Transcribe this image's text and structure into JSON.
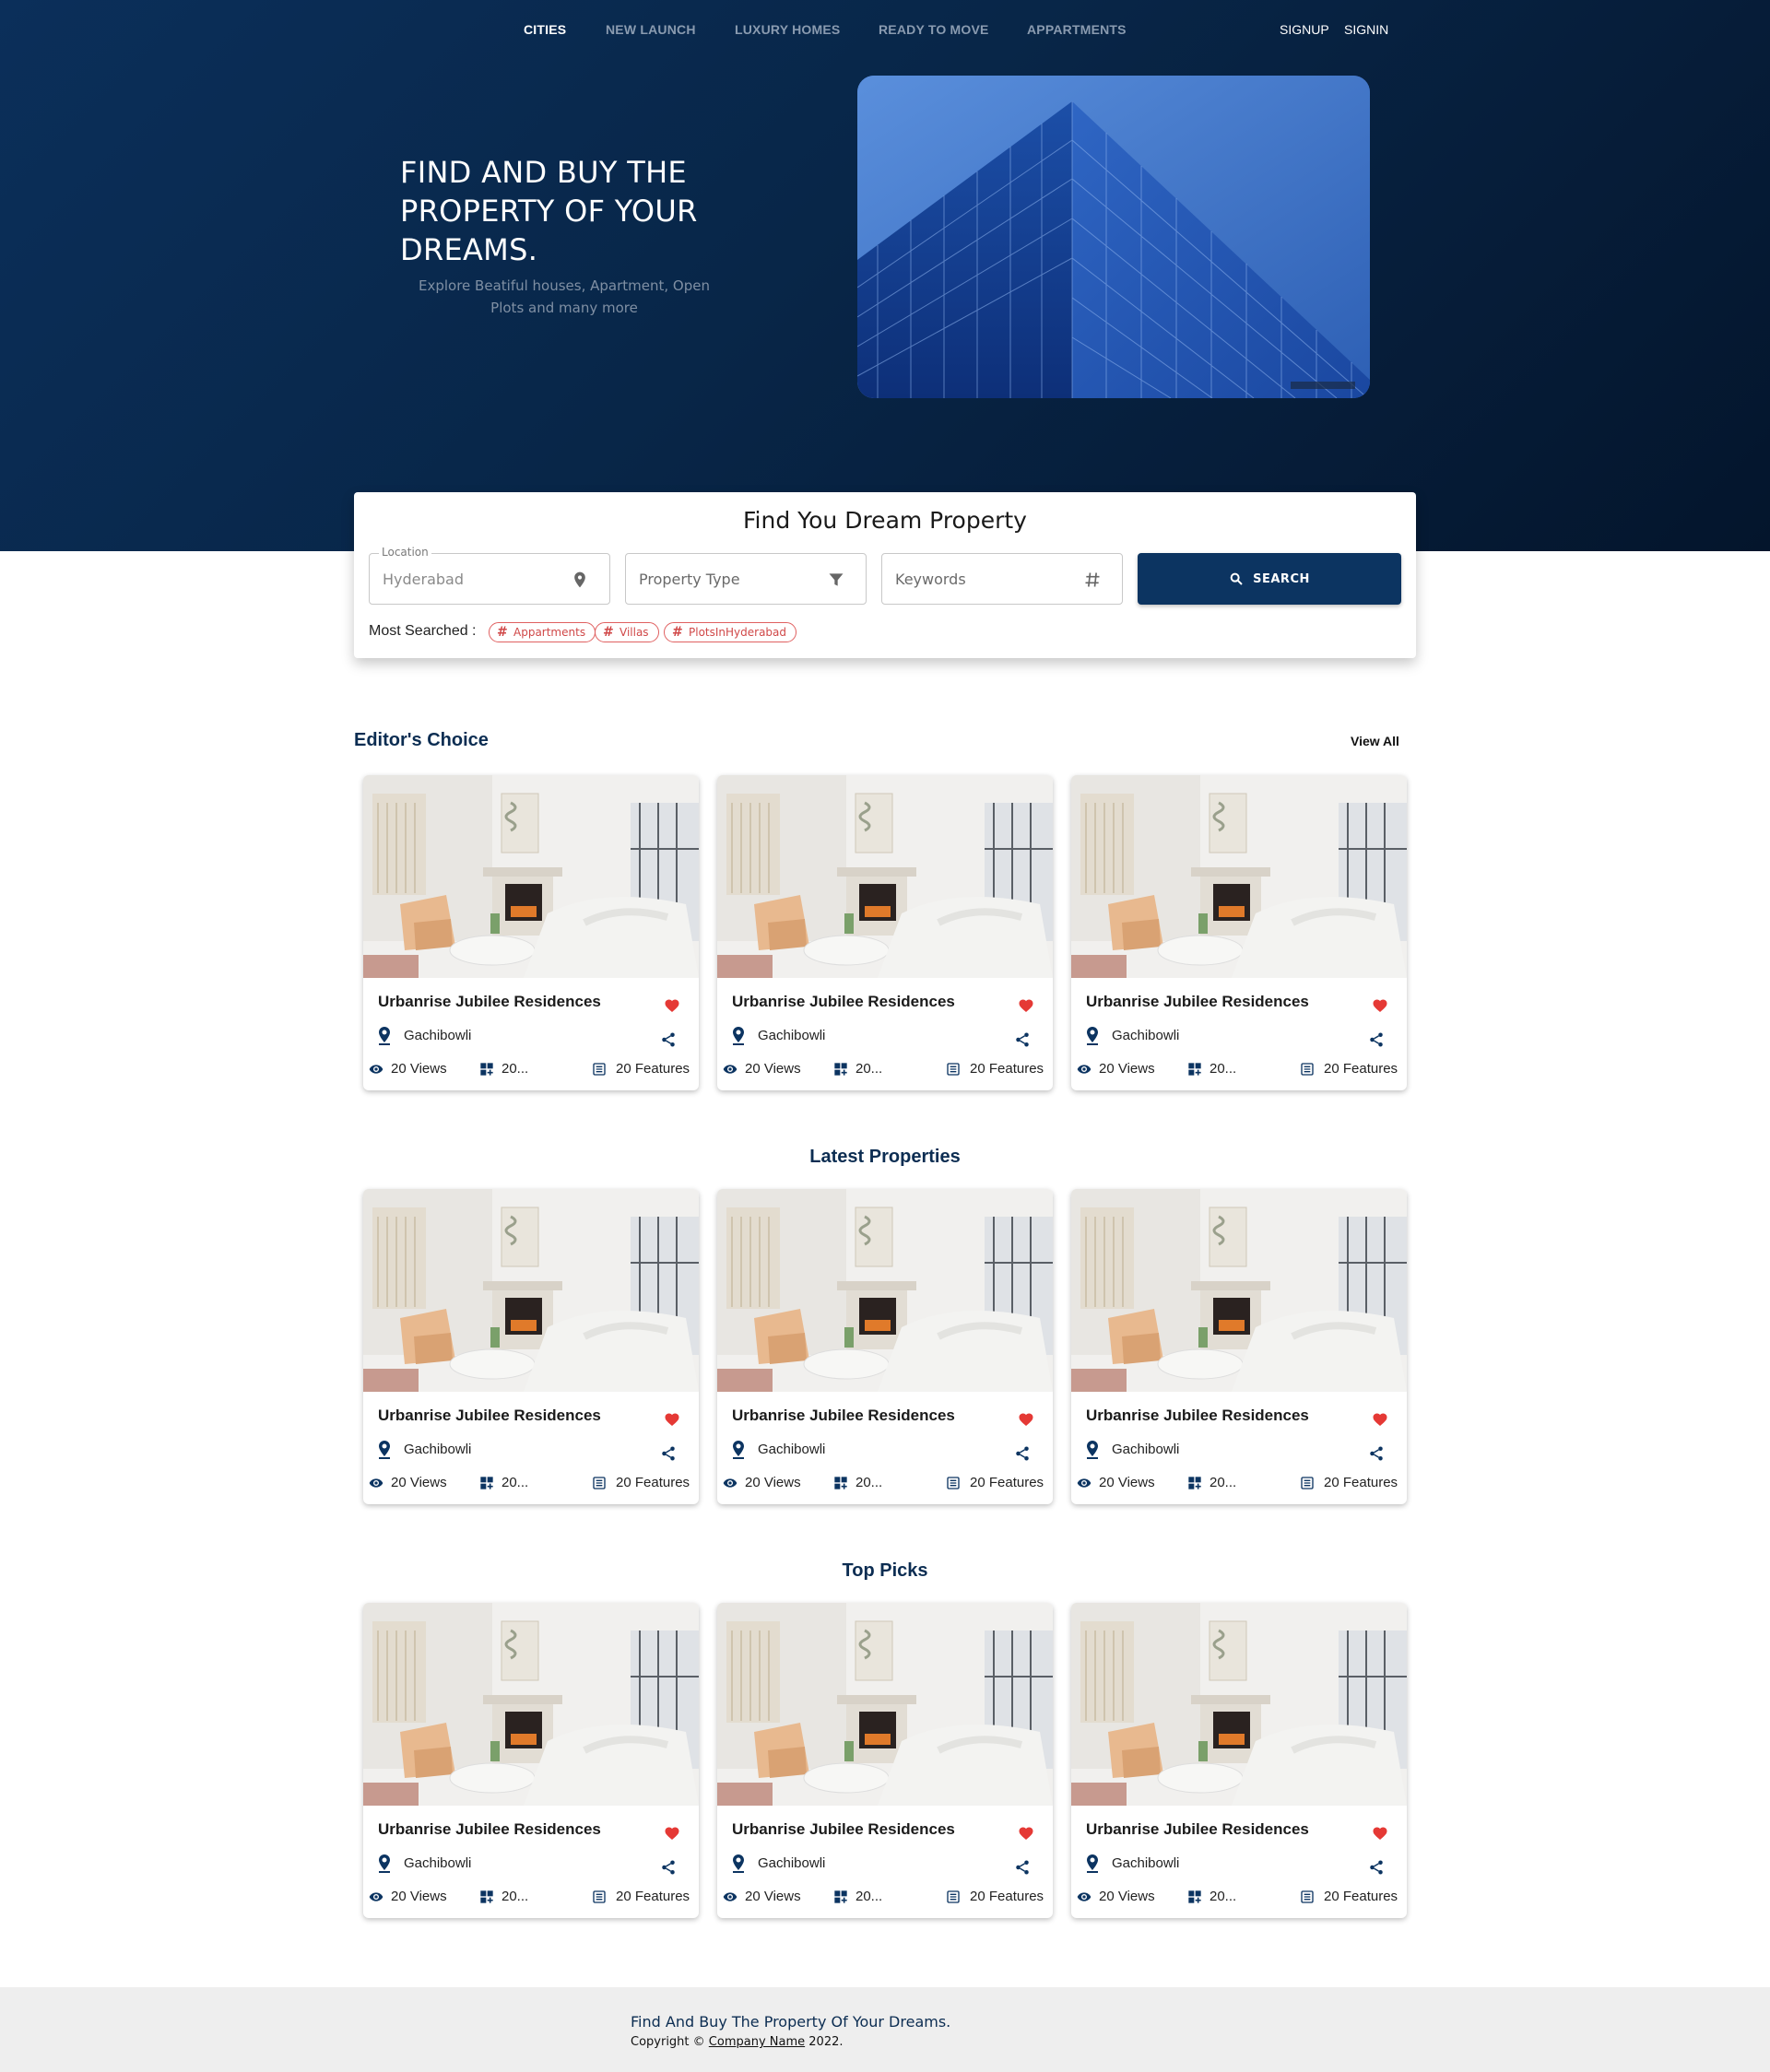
{
  "nav": {
    "links": [
      "CITIES",
      "NEW LAUNCH",
      "LUXURY HOMES",
      "READY TO MOVE",
      "APPARTMENTS"
    ],
    "signup": "SIGNUP",
    "signin": "SIGNIN"
  },
  "hero": {
    "title": "FIND AND BUY THE PROPERTY OF YOUR DREAMS.",
    "subtitle": "Explore Beatiful houses, Apartment, Open Plots and many more"
  },
  "search": {
    "title": "Find You Dream Property",
    "location_label": "Location",
    "location_value": "Hyderabad",
    "property_type_placeholder": "Property Type",
    "keywords_placeholder": "Keywords",
    "button_label": "SEARCH",
    "most_searched_label": "Most Searched :",
    "tags": [
      "Appartments",
      "Villas",
      "PlotsInHyderabad"
    ]
  },
  "sections": {
    "editors_choice": {
      "title": "Editor's Choice",
      "view_all": "View All"
    },
    "latest": {
      "title": "Latest Properties"
    },
    "top_picks": {
      "title": "Top Picks"
    }
  },
  "card": {
    "title": "Urbanrise Jubilee Residences",
    "location": "Gachibowli",
    "views": "20 Views",
    "area": "20...",
    "features": "20 Features"
  },
  "footer": {
    "tagline": "Find And Buy The Property Of Your Dreams.",
    "copy_prefix": "Copyright ©",
    "company": "Company Name",
    "year": "2022."
  },
  "colors": {
    "hero_dark": "#082648",
    "accent": "#0c3461",
    "heart": "#e53935",
    "tag": "#d04848"
  }
}
